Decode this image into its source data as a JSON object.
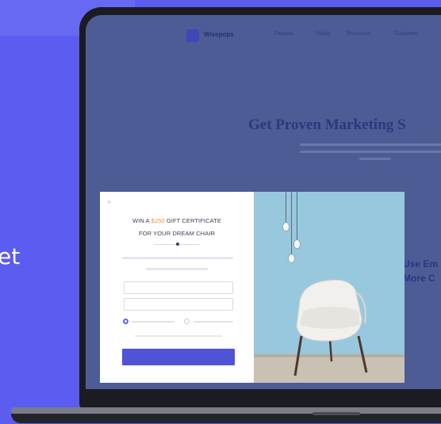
{
  "left_panel": {
    "partial_text": "et"
  },
  "site": {
    "brand": "Wisepops",
    "nav": [
      "Features",
      "Pricing",
      "Resources",
      "Customers"
    ],
    "hero_title": "Get Proven Marketing S",
    "side_text_line1": "Use Em",
    "side_text_line2": "More C"
  },
  "popup": {
    "close_symbol": "×",
    "headline_line1_before": "WIN A ",
    "headline_price": "$250",
    "headline_line1_after": " GIFT CERTIFICATE",
    "headline_line2": "FOR YOUR DREAM CHAIR",
    "name_placeholder": "",
    "email_placeholder": "",
    "cta_label": ""
  },
  "colors": {
    "background": "#5b5cf0",
    "accent": "#4f53d6",
    "price": "#e8923a",
    "image_bg": "#98c8de"
  }
}
